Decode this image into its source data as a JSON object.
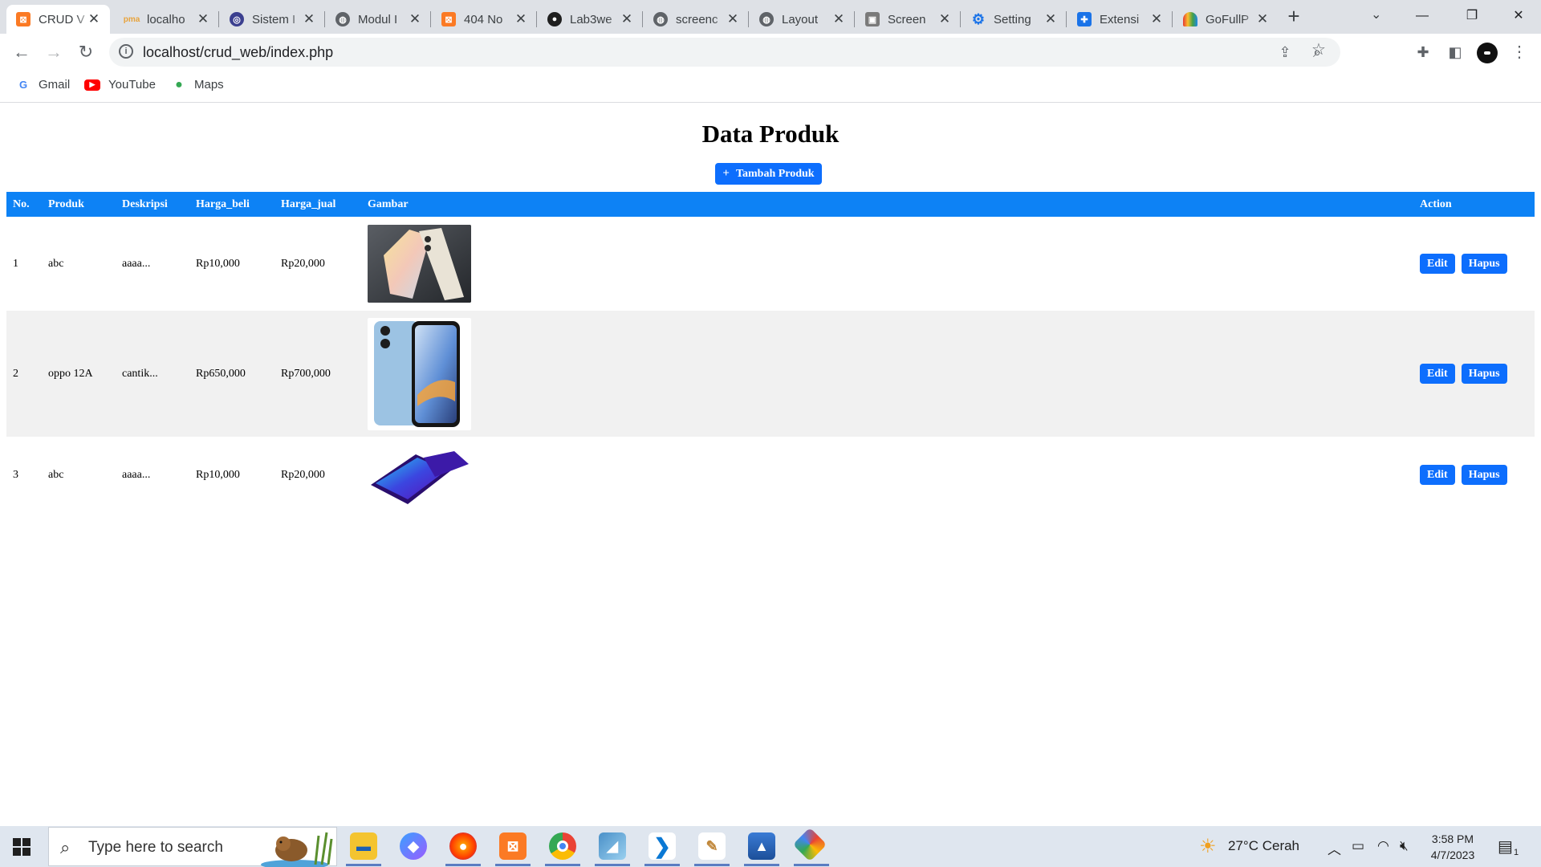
{
  "browser": {
    "tabs": [
      {
        "title": "CRUD V",
        "fav": "xampp",
        "active": true
      },
      {
        "title": "localho",
        "fav": "pma"
      },
      {
        "title": "Sistem I",
        "fav": "sistem"
      },
      {
        "title": "Modul I",
        "fav": "globe"
      },
      {
        "title": "404 No",
        "fav": "xampp"
      },
      {
        "title": "Lab3we",
        "fav": "github"
      },
      {
        "title": "screenc",
        "fav": "globe"
      },
      {
        "title": "Layout",
        "fav": "globe"
      },
      {
        "title": "Screen",
        "fav": "camera"
      },
      {
        "title": "Setting",
        "fav": "gear"
      },
      {
        "title": "Extensi",
        "fav": "puzzle"
      },
      {
        "title": "GoFullP",
        "fav": "rainbow"
      }
    ],
    "new_tab": "+",
    "url": "localhost/crud_web/index.php",
    "bookmarks": [
      {
        "label": "Gmail",
        "icon": "google-icon"
      },
      {
        "label": "YouTube",
        "icon": "youtube-icon"
      },
      {
        "label": "Maps",
        "icon": "maps-icon"
      }
    ]
  },
  "page": {
    "title": "Data Produk",
    "add_button": "Tambah Produk",
    "table": {
      "headers": [
        "No.",
        "Produk",
        "Deskripsi",
        "Harga_beli",
        "Harga_jual",
        "Gambar",
        "Action"
      ],
      "rows": [
        {
          "no": "1",
          "produk": "abc",
          "deskripsi": "aaaa...",
          "harga_beli": "Rp10,000",
          "harga_jual": "Rp20,000",
          "image": "phone-gold-image"
        },
        {
          "no": "2",
          "produk": "oppo 12A",
          "deskripsi": "cantik...",
          "harga_beli": "Rp650,000",
          "harga_jual": "Rp700,000",
          "image": "phone-blue-image"
        },
        {
          "no": "3",
          "produk": "abc",
          "deskripsi": "aaaa...",
          "harga_beli": "Rp10,000",
          "harga_jual": "Rp20,000",
          "image": "phone-purple-image"
        }
      ],
      "edit_label": "Edit",
      "delete_label": "Hapus"
    }
  },
  "taskbar": {
    "search_placeholder": "Type here to search",
    "weather": "27°C  Cerah",
    "time": "3:58 PM",
    "date": "4/7/2023",
    "notification_count": "1"
  },
  "colors": {
    "primary_button": "#0d6efd",
    "table_header": "#0d82f5",
    "striped_row": "#f1f1f1"
  }
}
